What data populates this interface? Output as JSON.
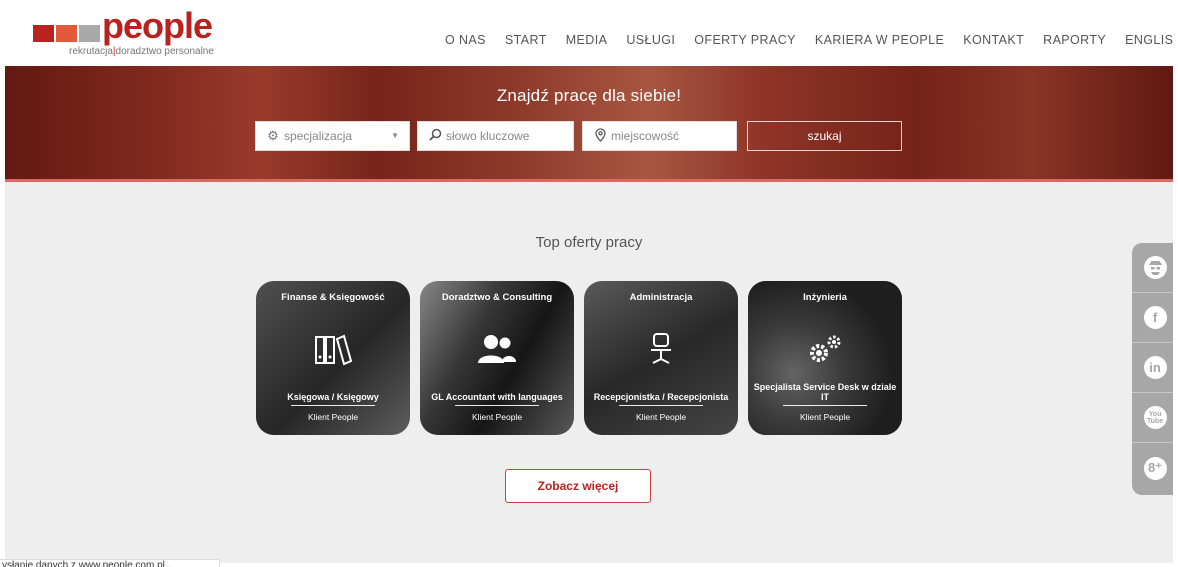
{
  "logo": {
    "word": "people",
    "tagline_a": "rekrutacja",
    "tagline_b": "doradztwo personalne",
    "colors": {
      "brand": "#b8231f",
      "accent": "#df5b3b",
      "grey": "#a9a9a9"
    }
  },
  "nav": {
    "items": [
      "O NAS",
      "START",
      "MEDIA",
      "USŁUGI",
      "OFERTY PRACY",
      "KARIERA W PEOPLE",
      "KONTAKT",
      "RAPORTY",
      "ENGLISH"
    ]
  },
  "hero": {
    "title": "Znajdź pracę dla siebie!",
    "specialization": {
      "placeholder": "specjalizacja",
      "icon": "gear-icon"
    },
    "keyword": {
      "placeholder": "słowo kluczowe",
      "icon": "search-icon"
    },
    "location": {
      "placeholder": "miejscowość",
      "icon": "location-pin-icon"
    },
    "search_button": "szukaj"
  },
  "main": {
    "section_title": "Top oferty pracy",
    "cards": [
      {
        "category": "Finanse & Księgowość",
        "icon": "binders-icon",
        "job": "Księgowa / Księgowy",
        "client": "Klient People"
      },
      {
        "category": "Doradztwo & Consulting",
        "icon": "people-icon",
        "job": "GL Accountant with languages",
        "client": "Klient People"
      },
      {
        "category": "Administracja",
        "icon": "office-chair-icon",
        "job": "Recepcjonistka / Recepcjonista",
        "client": "Klient People"
      },
      {
        "category": "Inżynieria",
        "icon": "gears-icon",
        "job": "Specjalista Service Desk w dziale IT",
        "client": "Klient People"
      }
    ],
    "more_button": "Zobacz więcej"
  },
  "social": {
    "items": [
      "spy-icon",
      "facebook-icon",
      "linkedin-icon",
      "youtube-icon",
      "google-plus-icon"
    ],
    "labels": {
      "facebook": "f",
      "linkedin": "in",
      "youtube_a": "You",
      "youtube_b": "Tube",
      "google": "8⁺"
    }
  },
  "status_bar": {
    "text": "ysłanie danych z www.people.com.pl..."
  }
}
